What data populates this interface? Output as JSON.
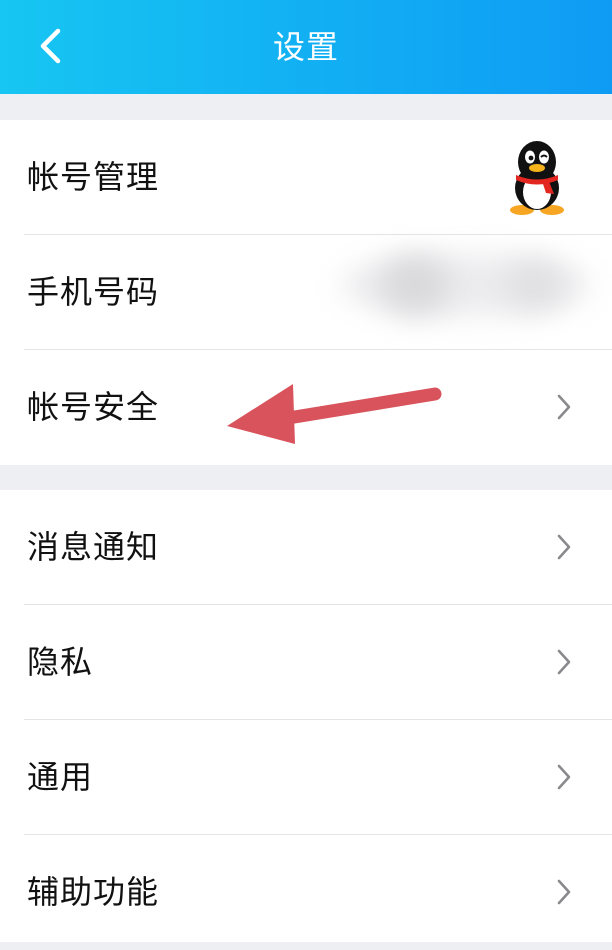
{
  "header": {
    "title": "设置",
    "back_icon": "chevron-left-icon"
  },
  "groups": [
    {
      "items": [
        {
          "label": "帐号管理",
          "trailing": "qq-penguin-avatar"
        },
        {
          "label": "手机号码",
          "trailing": "blurred-value"
        },
        {
          "label": "帐号安全",
          "trailing": "chevron-right-icon"
        }
      ]
    },
    {
      "items": [
        {
          "label": "消息通知",
          "trailing": "chevron-right-icon"
        },
        {
          "label": "隐私",
          "trailing": "chevron-right-icon"
        },
        {
          "label": "通用",
          "trailing": "chevron-right-icon"
        },
        {
          "label": "辅助功能",
          "trailing": "chevron-right-icon"
        }
      ]
    }
  ],
  "colors": {
    "header_gradient_start": "#17c6f2",
    "header_gradient_end": "#0f9bf4",
    "background": "#eeeff3",
    "annotation_arrow": "#d9535c"
  }
}
